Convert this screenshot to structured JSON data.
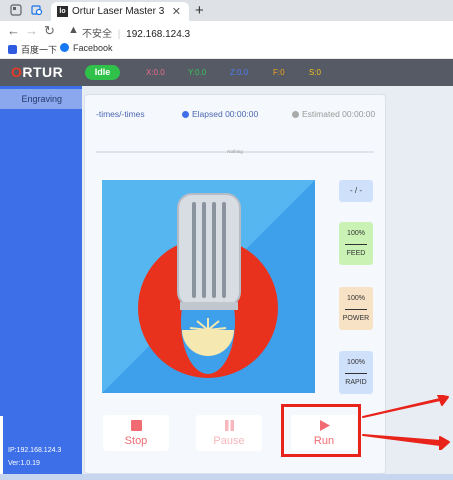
{
  "browser": {
    "tab_title": "Ortur Laser Master 3",
    "tab_favicon_text": "lo",
    "new_tab_icon": "plus-icon",
    "address": {
      "security_label": "不安全",
      "separator": "|",
      "url": "192.168.124.3"
    },
    "bookmarks": [
      {
        "label": "百度一下"
      },
      {
        "label": "Facebook"
      }
    ]
  },
  "app": {
    "logo_first": "O",
    "logo_rest": "RTUR",
    "status_badge": "Idle",
    "coords": [
      {
        "label": "X:0.0",
        "color": "#ef6b8a"
      },
      {
        "label": "Y:0.0",
        "color": "#37c45a"
      },
      {
        "label": "Z:0.0",
        "color": "#4f7ef0"
      },
      {
        "label": "F:0",
        "color": "#f2a21e"
      },
      {
        "label": "S:0",
        "color": "#f2c01e"
      }
    ],
    "sidebar": {
      "items": [
        {
          "label": "Engraving",
          "active": true
        }
      ],
      "ip": "IP:192.168.124.3",
      "version": "Ver:1.0.19"
    },
    "job": {
      "times": "-times/-times",
      "elapsed": "Elapsed 00:00:00",
      "estimated": "Estimated 00:00:00",
      "progress_label": "Nothing",
      "progress_value": 0
    },
    "gauges": {
      "pass": {
        "label": "- / -"
      },
      "feed": {
        "percent": "100%",
        "label": "FEED",
        "color": "#c9f2b4"
      },
      "power": {
        "percent": "100%",
        "label": "POWER",
        "color": "#f8e2c6"
      },
      "rapid": {
        "percent": "100%",
        "label": "RAPID",
        "color": "#cfe0fb"
      }
    },
    "controls": {
      "stop": {
        "label": "Stop",
        "icon": "stop-icon",
        "color": "#f06b72"
      },
      "pause": {
        "label": "Pause",
        "icon": "pause-icon",
        "color": "#f7b7bc"
      },
      "run": {
        "label": "Run",
        "icon": "play-icon",
        "color": "#f06b72"
      }
    },
    "colors": {
      "sidebar": "#3c6fe8",
      "header": "#555a64",
      "accent_red": "#e8231a"
    }
  }
}
